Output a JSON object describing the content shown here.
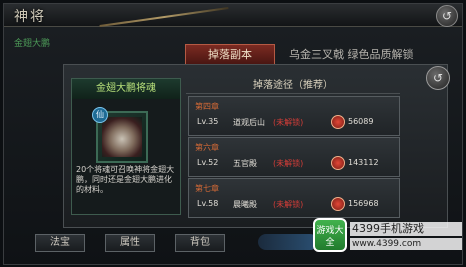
{
  "header": {
    "title": "神将",
    "back_icon": "↺"
  },
  "left_tree_label": "金翅大鹏",
  "tabs": {
    "active": "掉落副本",
    "other": "乌金三叉戟   绿色品质解锁"
  },
  "item": {
    "name": "金翅大鹏将魂",
    "badge": "仙",
    "description": "20个将魂可召唤神将金翅大鹏，同时还是金翅大鹏进化的材料。"
  },
  "panel": {
    "title": "掉落途径（推荐）",
    "back_icon": "↺"
  },
  "drops": [
    {
      "chapter": "第四章",
      "level": "Lv.35",
      "location": "道观后山",
      "status": "(未解锁)",
      "coins": "56089"
    },
    {
      "chapter": "第六章",
      "level": "Lv.52",
      "location": "五官殿",
      "status": "(未解锁)",
      "coins": "143112"
    },
    {
      "chapter": "第七章",
      "level": "Lv.58",
      "location": "晨曦殿",
      "status": "(未解锁)",
      "coins": "156968"
    }
  ],
  "bottom_tabs": [
    "法宝",
    "属性",
    "背包"
  ],
  "watermark": {
    "logo": "游戏大全",
    "brand": "4399手机游戏",
    "url": "www.4399.com"
  }
}
